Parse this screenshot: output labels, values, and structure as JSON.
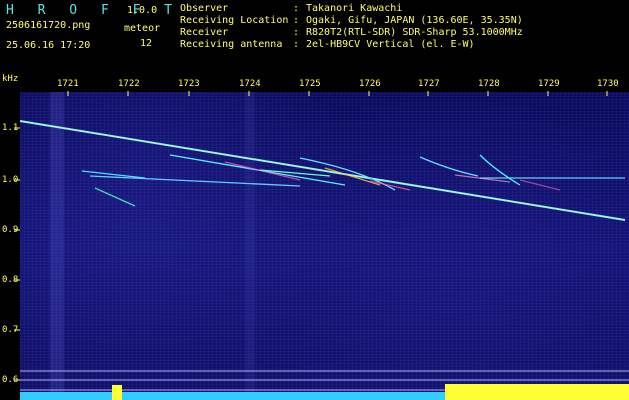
{
  "app": {
    "logo": "H R O F F T",
    "version": "1.0.0"
  },
  "file": {
    "name": "2506161720.png",
    "timestamp": "25.06.16 17:20"
  },
  "meteor": {
    "label": "meteor",
    "count": "12"
  },
  "info": [
    {
      "key": "Observer",
      "value": "Takanori Kawachi"
    },
    {
      "key": "Receiving Location",
      "value": "Ogaki, Gifu, JAPAN (136.60E, 35.35N)"
    },
    {
      "key": "Receiver",
      "value": "R820T2(RTL-SDR) SDR-Sharp 53.1000MHz"
    },
    {
      "key": "Receiving antenna",
      "value": "2el-HB9CV Vertical (el. E-W)"
    }
  ],
  "axis": {
    "y_unit": "kHz",
    "x_ticks": [
      "1721",
      "1722",
      "1723",
      "1724",
      "1725",
      "1726",
      "1727",
      "1728",
      "1729",
      "1730"
    ],
    "y_ticks": [
      "1.1",
      "1.0",
      "0.9",
      "0.8",
      "0.7",
      "0.6"
    ]
  },
  "colors": {
    "text": "#ffff66",
    "logo": "#57e4ec",
    "background": "#000000",
    "spectrum": "#121270",
    "trace": "#7cf0ff",
    "noise_floor": "#33ccff",
    "noise_spike": "#ffff33"
  }
}
